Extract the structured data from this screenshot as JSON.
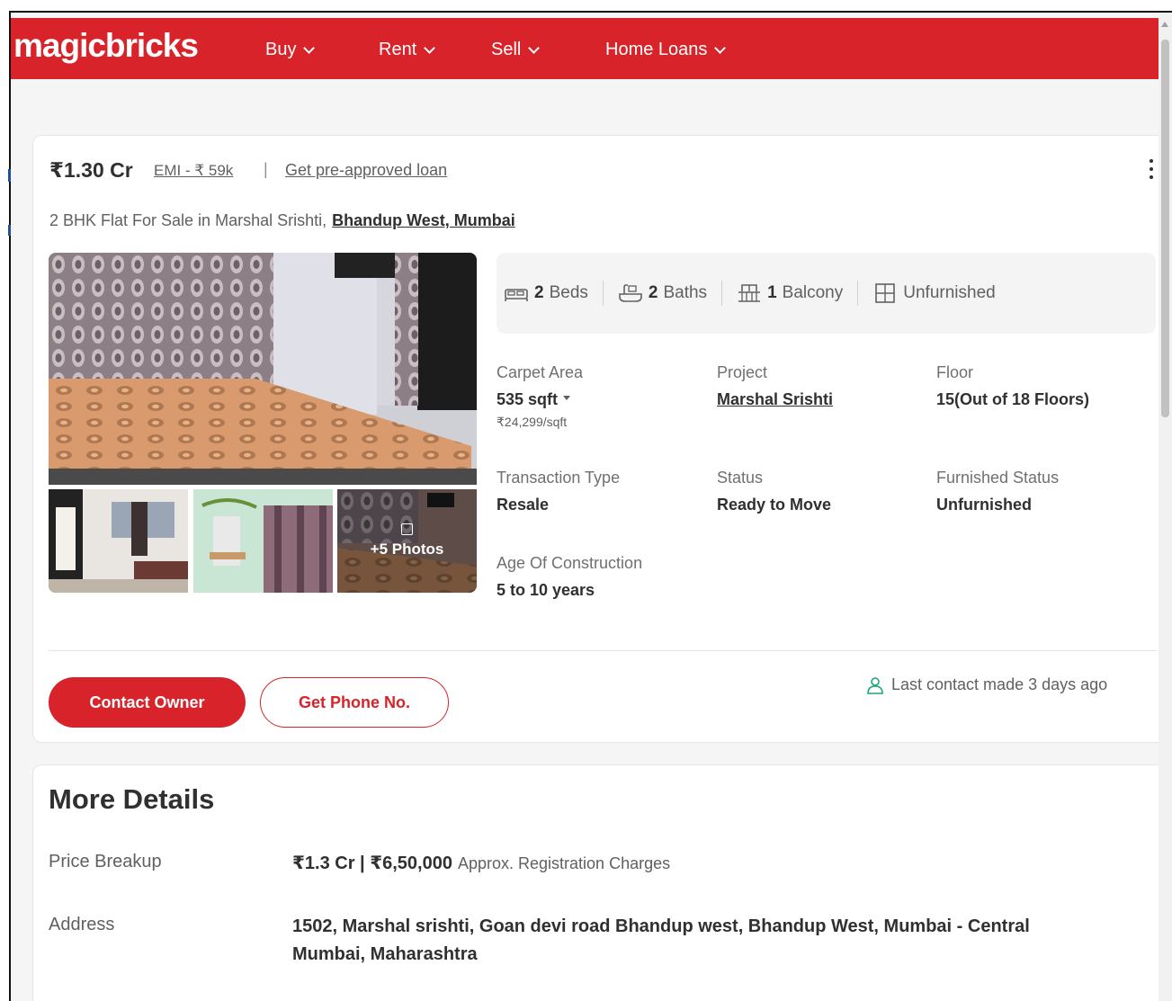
{
  "brand": {
    "logo_text": "magicbricks",
    "color": "#d8232a"
  },
  "nav": {
    "items": [
      {
        "label": "Buy"
      },
      {
        "label": "Rent"
      },
      {
        "label": "Sell"
      },
      {
        "label": "Home Loans"
      }
    ]
  },
  "listing": {
    "price": "₹1.30 Cr",
    "emi": "EMI - ₹ 59k",
    "separator": "|",
    "loan_link": "Get pre-approved loan",
    "title": "2 BHK Flat For Sale in Marshal Srishti,",
    "location": "Bhandup West, Mumbai",
    "photos": {
      "more_label": "+5 Photos"
    },
    "amenities": [
      {
        "icon": "bed-icon",
        "value": "2",
        "label": "Beds"
      },
      {
        "icon": "bath-icon",
        "value": "2",
        "label": "Baths"
      },
      {
        "icon": "balcony-icon",
        "value": "1",
        "label": "Balcony"
      },
      {
        "icon": "furnishing-icon",
        "value": "",
        "label": "Unfurnished"
      }
    ],
    "specs": {
      "carpet_area": {
        "label": "Carpet Area",
        "value": "535 sqft",
        "sub": "₹24,299/sqft"
      },
      "project": {
        "label": "Project",
        "value": "Marshal Srishti"
      },
      "floor": {
        "label": "Floor",
        "value": "15(Out of 18 Floors)"
      },
      "transaction": {
        "label": "Transaction Type",
        "value": "Resale"
      },
      "status": {
        "label": "Status",
        "value": "Ready to Move"
      },
      "furnished": {
        "label": "Furnished Status",
        "value": "Unfurnished"
      },
      "age": {
        "label": "Age Of Construction",
        "value": "5 to 10 years"
      }
    },
    "actions": {
      "contact_owner": "Contact Owner",
      "get_phone": "Get Phone No.",
      "last_contact": "Last contact made 3 days ago"
    }
  },
  "more_details": {
    "title": "More Details",
    "price_breakup": {
      "label": "Price Breakup",
      "value": "₹1.3 Cr | ₹6,50,000",
      "note": "Approx. Registration Charges"
    },
    "address": {
      "label": "Address",
      "value": "1502, Marshal srishti, Goan devi road Bhandup west, Bhandup West, Mumbai - Central Mumbai, Maharashtra"
    }
  }
}
